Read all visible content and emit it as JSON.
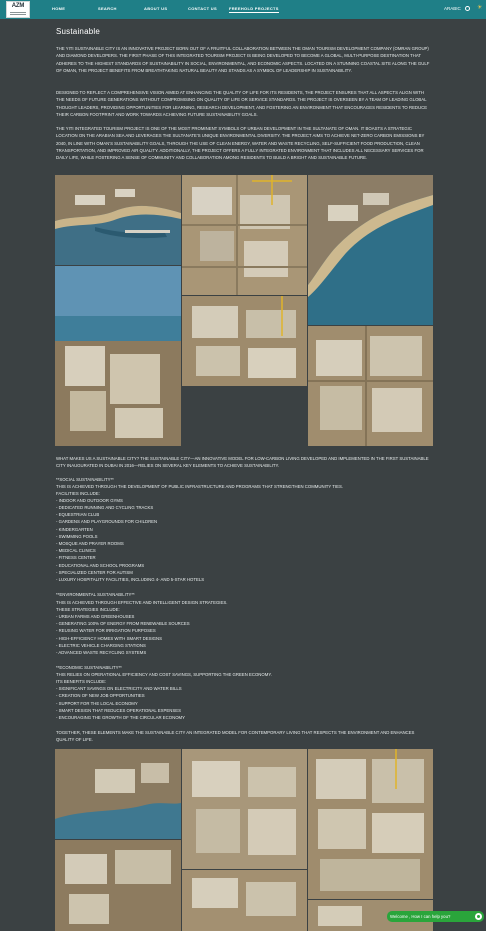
{
  "header": {
    "logo_text": "AZM",
    "nav": [
      {
        "label": "HOME"
      },
      {
        "label": "SEARCH"
      },
      {
        "label": "ABOUT US"
      },
      {
        "label": "CONTACT US"
      },
      {
        "label": "FREEHOLD PROJECTS"
      }
    ],
    "language": "ARABIC",
    "globe_icon": "globe-icon",
    "theme_icon": "sun-icon"
  },
  "main": {
    "title": "Sustainable",
    "intro": [
      "The Yiti Sustainable City is an innovative project born out of a fruitful collaboration between the Oman Tourism Development Company (Omran Group) and Diamond Developers. The first phase of this integrated tourism project is being developed to become a global, multi-purpose destination that adheres to the highest standards of sustainability in social, environmental, and economic aspects. Located on a stunning coastal site along the Gulf of Oman, the project benefits from breathtaking natural beauty and stands as a symbol of leadership in sustainability.",
      "Designed to reflect a comprehensive vision aimed at enhancing the quality of life for its residents, the project ensures that all aspects align with the needs of future generations without compromising on quality of life or service standards. The project is overseen by a team of leading global thought leaders, providing opportunities for learning, research development, and fostering an environment that encourages residents to reduce their carbon footprint and work towards achieving future sustainability goals.",
      "The Yiti integrated tourism project is one of the most prominent symbols of urban development in the Sultanate of Oman. It boasts a strategic location on the Arabian Sea and leverages the Sultanate's unique environmental diversity. The project aims to achieve net-zero carbon emissions by 2040, in line with Oman's sustainability goals, through the use of clean energy, water and waste recycling, self-sufficient food production, clean transportation, and improved air quality. Additionally, the project offers a fully integrated environment that includes all necessary services for daily life, while fostering a sense of community and collaboration among residents to build a bright and sustainable future."
    ],
    "why_text": "What makes us a sustainable city? The Sustainable City—an innovative model for low-carbon living developed and implemented in the first sustainable city inaugurated in Dubai in 2016—relies on several key elements to achieve sustainability.",
    "social": {
      "heading": "**Social Sustainability**",
      "intro": "This is achieved through the development of public infrastructure and programs that strengthen community ties.",
      "list_title": "Facilities include:",
      "items": [
        "- Indoor and outdoor gyms",
        "- Dedicated running and cycling tracks",
        "- Equestrian club",
        "- Gardens and playgrounds for children",
        "- Kindergarten",
        "- Swimming pools",
        "- Mosque and prayer rooms",
        "- Medical clinics",
        "- Fitness center",
        "- Educational and school programs",
        "- Specialized center for autism",
        "- Luxury hospitality facilities, including 4- and 5-star hotels"
      ]
    },
    "environmental": {
      "heading": "**Environmental Sustainability**",
      "intro": "This is achieved through effective and intelligent design strategies.",
      "list_title": "These strategies include:",
      "items": [
        "- Urban farms and greenhouses",
        "- Generating 100% of energy from renewable sources",
        "- Reusing water for irrigation purposes",
        "- High-efficiency homes with smart designs",
        "- Electric vehicle charging stations",
        "- Advanced waste recycling systems"
      ]
    },
    "economic": {
      "heading": "**Economic Sustainability**",
      "intro": "This relies on operational efficiency and cost savings, supporting the green economy.",
      "list_title": "Its benefits include:",
      "items": [
        "- Significant savings on electricity and water bills",
        "- Creation of new job opportunities",
        "- Support for the local economy",
        "- Smart design that reduces operational expenses",
        "- Encouraging the growth of the circular economy"
      ]
    },
    "closing": "Together, these elements make the Sustainable City an integrated model for contemporary living that respects the environment and enhances quality of life."
  },
  "chat": {
    "label": "Welcome , How I can help you?",
    "icon": "whatsapp-icon"
  },
  "colors": {
    "background": "#3b4143",
    "header": "#1f7f87",
    "chat": "#2aa53b"
  }
}
